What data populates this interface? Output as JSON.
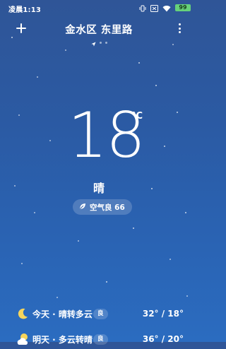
{
  "status": {
    "time": "凌晨1:13",
    "battery": "99"
  },
  "header": {
    "location": "金水区 东里路"
  },
  "current": {
    "temperature": "18",
    "unit": "°C",
    "condition": "晴",
    "aqi_label": "空气良 66"
  },
  "forecast": [
    {
      "day": "今天 · 晴转多云",
      "aqi": "良",
      "range": "32° / 18°",
      "icon": "crescent-moon-icon"
    },
    {
      "day": "明天 · 多云转晴",
      "aqi": "良",
      "range": "36° / 20°",
      "icon": "sun-cloud-icon"
    }
  ],
  "colors": {
    "bg_top": "#2f5597",
    "bg_bottom": "#2b6cc0",
    "moon": "#f6d55c"
  }
}
